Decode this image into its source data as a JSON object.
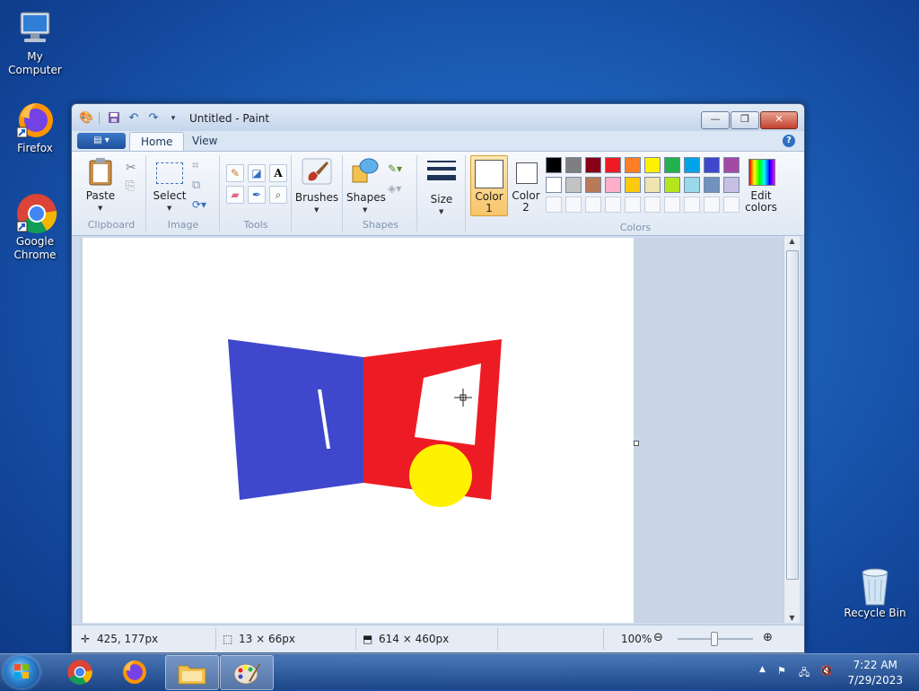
{
  "desktop": {
    "icons": [
      {
        "label": "My Computer"
      },
      {
        "label": "Firefox"
      },
      {
        "label": "Google Chrome"
      },
      {
        "label": "Recycle Bin"
      }
    ]
  },
  "window": {
    "title": "Untitled - Paint",
    "tabs": [
      {
        "label": "Home"
      },
      {
        "label": "View"
      }
    ],
    "active_tab": "Home",
    "help": "?"
  },
  "ribbon": {
    "groups": {
      "clipboard": {
        "label": "Clipboard",
        "paste": "Paste"
      },
      "image": {
        "label": "Image",
        "select": "Select"
      },
      "tools": {
        "label": "Tools"
      },
      "brushes": {
        "label": "Brushes"
      },
      "shapes": {
        "label": "Shapes",
        "button": "Shapes"
      },
      "size": {
        "label": "Size"
      },
      "colors": {
        "label": "Colors",
        "color1": "Color 1",
        "color1_line1": "Color",
        "color1_line2": "1",
        "color2_line1": "Color",
        "color2_line2": "2",
        "color1_value": "#ffffff",
        "color2_value": "#ffffff",
        "edit_line1": "Edit",
        "edit_line2": "colors",
        "palette_row1": [
          "#000000",
          "#7f7f7f",
          "#880015",
          "#ed1c24",
          "#ff7f27",
          "#fff200",
          "#22b14c",
          "#00a2e8",
          "#3f48cc",
          "#a349a4"
        ],
        "palette_row2": [
          "#ffffff",
          "#c3c3c3",
          "#b97a57",
          "#ffaec9",
          "#ffc90e",
          "#efe4b0",
          "#b5e61d",
          "#99d9ea",
          "#7092be",
          "#c8bfe7"
        ]
      }
    }
  },
  "canvas_drawing": {
    "blue_panel_color": "#3f48cc",
    "red_panel_color": "#ed1c24",
    "yellow_circle_color": "#fff200"
  },
  "statusbar": {
    "cursor_pos": "425, 177px",
    "selection_size": "13 × 66px",
    "image_size": "614 × 460px",
    "zoom": "100%"
  },
  "taskbar": {
    "time": "7:22 AM",
    "date": "7/29/2023"
  }
}
